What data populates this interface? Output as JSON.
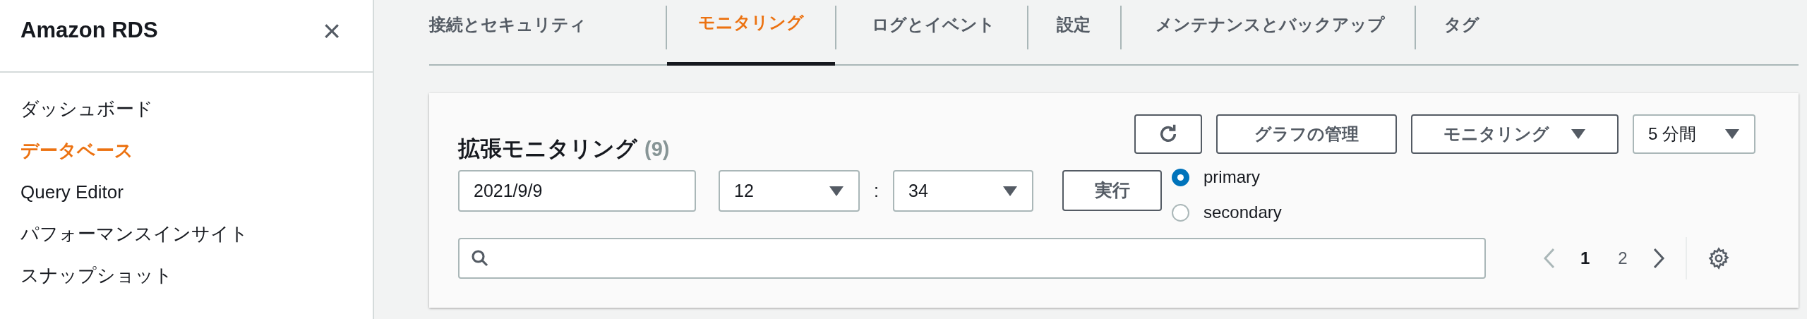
{
  "sidebar": {
    "title": "Amazon RDS",
    "close": "×",
    "items": [
      {
        "label": "ダッシュボード",
        "selected": false
      },
      {
        "label": "データベース",
        "selected": true
      },
      {
        "label": "Query Editor",
        "selected": false
      },
      {
        "label": "パフォーマンスインサイト",
        "selected": false
      },
      {
        "label": "スナップショット",
        "selected": false
      }
    ]
  },
  "tabs": [
    {
      "label": "接続とセキュリティ",
      "selected": false
    },
    {
      "label": "モニタリング",
      "selected": true
    },
    {
      "label": "ログとイベント",
      "selected": false
    },
    {
      "label": "設定",
      "selected": false
    },
    {
      "label": "メンテナンスとバックアップ",
      "selected": false
    },
    {
      "label": "タグ",
      "selected": false
    }
  ],
  "panel": {
    "title": "拡張モニタリング",
    "count": "(9)",
    "buttons": [
      {
        "kind": "icon"
      },
      {
        "kind": "text",
        "label": "グラフの管理"
      },
      {
        "kind": "dropdown",
        "label": "モニタリング"
      }
    ],
    "interval": "5 分間",
    "date": "2021/9/9",
    "hour": "12",
    "separator": ":",
    "minute": "34",
    "run": "実行",
    "instances": [
      {
        "label": "primary",
        "selected": true
      },
      {
        "label": "secondary",
        "selected": false
      }
    ],
    "pagination": {
      "pages": [
        {
          "label": "1",
          "selected": true
        },
        {
          "label": "2",
          "selected": false
        }
      ]
    }
  }
}
